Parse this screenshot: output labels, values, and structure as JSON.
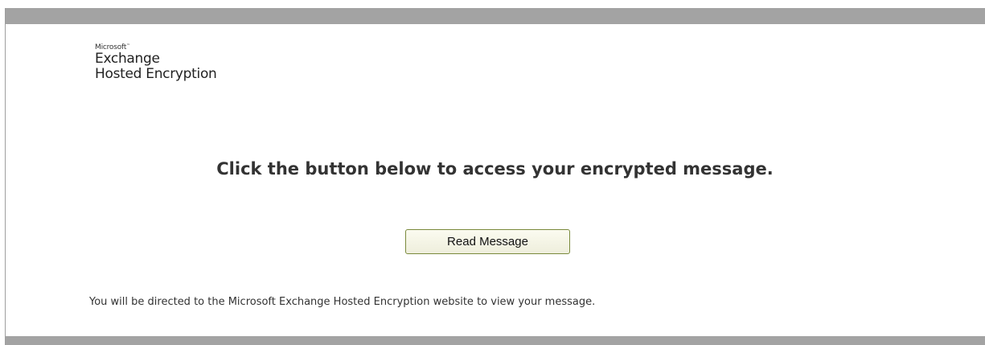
{
  "logo": {
    "brand": "Microsoft",
    "line1": "Exchange",
    "line2": "Hosted Encryption"
  },
  "main": {
    "headline": "Click the button below to access your encrypted message.",
    "read_button_label": "Read Message",
    "footnote": "You will be directed to the Microsoft Exchange Hosted Encryption website to view your message."
  },
  "colors": {
    "bar": "#a3a3a3",
    "button_border": "#7a8a3c",
    "text": "#333333"
  }
}
